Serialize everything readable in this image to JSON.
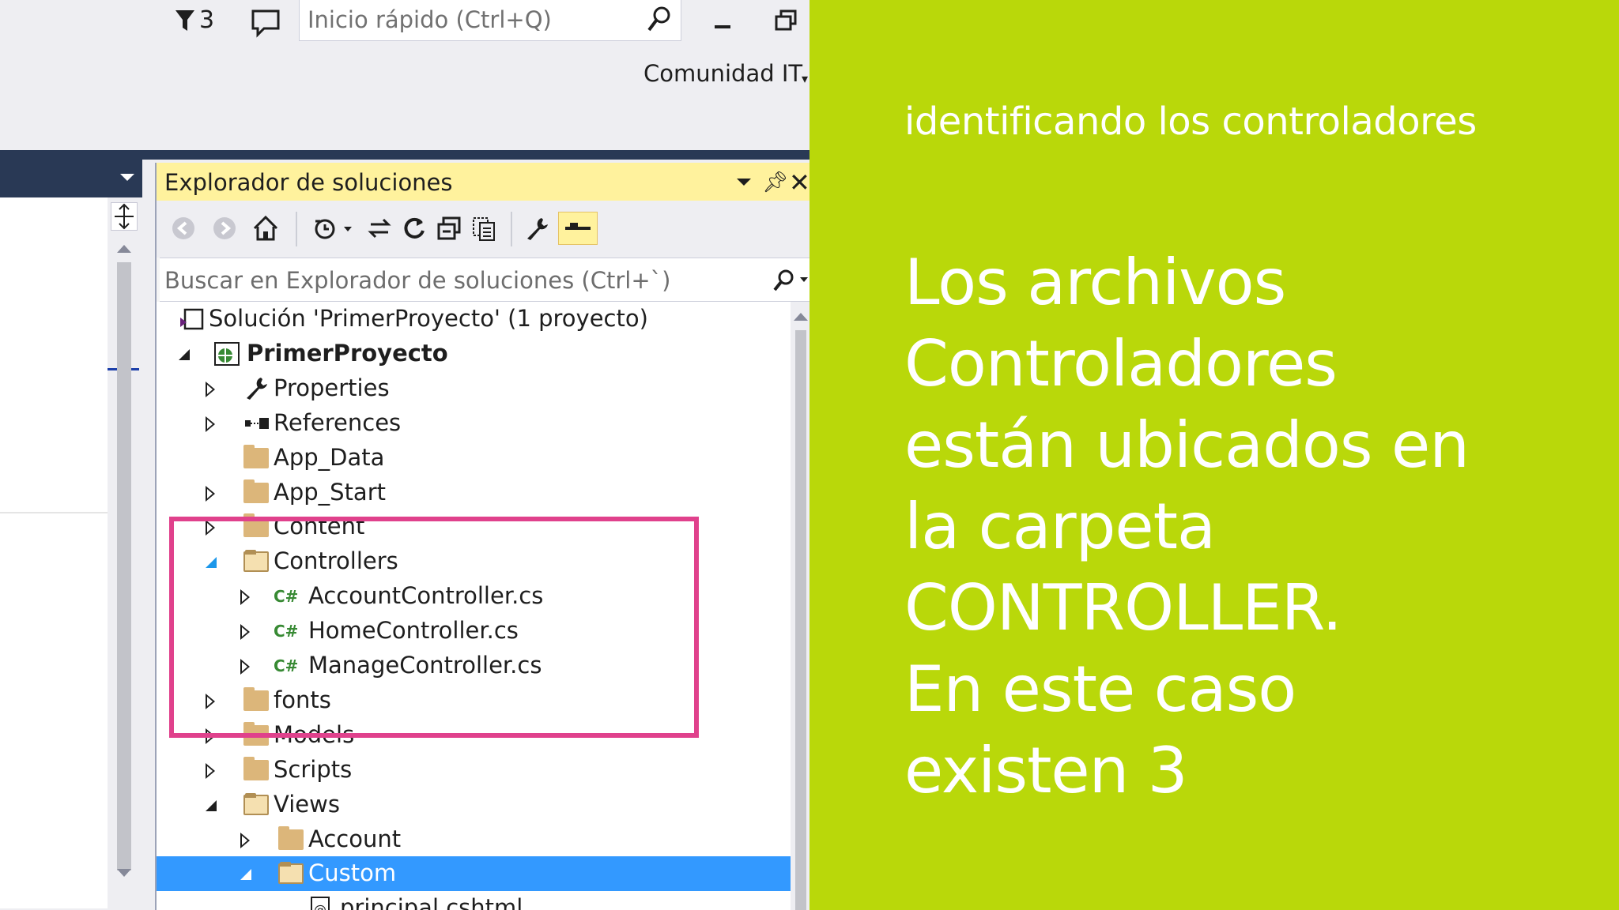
{
  "titlebar": {
    "notification_count": "3",
    "quick_launch_placeholder": "Inicio rápido (Ctrl+Q)",
    "account_name": "Comunidad IT"
  },
  "solution_explorer": {
    "title": "Explorador de soluciones",
    "search_placeholder": "Buscar en Explorador de soluciones (Ctrl+`)",
    "tree": [
      {
        "label": "Solución 'PrimerProyecto'  (1 proyecto)",
        "icon": "solution-icon",
        "expander": "none"
      },
      {
        "label": "PrimerProyecto",
        "icon": "web-project-icon",
        "expander": "open",
        "bold": true
      },
      {
        "label": "Properties",
        "icon": "wrench-icon",
        "expander": "closed"
      },
      {
        "label": "References",
        "icon": "references-icon",
        "expander": "closed"
      },
      {
        "label": "App_Data",
        "icon": "folder-icon",
        "expander": "none"
      },
      {
        "label": "App_Start",
        "icon": "folder-icon",
        "expander": "closed"
      },
      {
        "label": "Content",
        "icon": "folder-icon",
        "expander": "closed"
      },
      {
        "label": "Controllers",
        "icon": "folder-open-icon",
        "expander": "open-blue"
      },
      {
        "label": "AccountController.cs",
        "icon": "csharp-file-icon",
        "expander": "closed"
      },
      {
        "label": "HomeController.cs",
        "icon": "csharp-file-icon",
        "expander": "closed"
      },
      {
        "label": "ManageController.cs",
        "icon": "csharp-file-icon",
        "expander": "closed"
      },
      {
        "label": "fonts",
        "icon": "folder-icon",
        "expander": "closed"
      },
      {
        "label": "Models",
        "icon": "folder-icon",
        "expander": "closed"
      },
      {
        "label": "Scripts",
        "icon": "folder-icon",
        "expander": "closed"
      },
      {
        "label": "Views",
        "icon": "folder-open-icon",
        "expander": "open"
      },
      {
        "label": "Account",
        "icon": "folder-icon",
        "expander": "closed"
      },
      {
        "label": "Custom",
        "icon": "folder-open-icon",
        "expander": "open",
        "selected": true
      },
      {
        "label": "principal.cshtml",
        "icon": "razor-file-icon",
        "expander": "none"
      }
    ]
  },
  "slide": {
    "subtitle": "identificando los controladores",
    "body_lines": [
      "Los archivos",
      "Controladores",
      "están ubicados en",
      "la carpeta",
      "CONTROLLER.",
      "En este caso",
      "existen 3"
    ]
  },
  "colors": {
    "green_panel": "#b9d80a",
    "highlight_box": "#e0418c",
    "selection": "#3399ff",
    "panel_title_bar": "#fff29d",
    "navy_band": "#293955"
  }
}
